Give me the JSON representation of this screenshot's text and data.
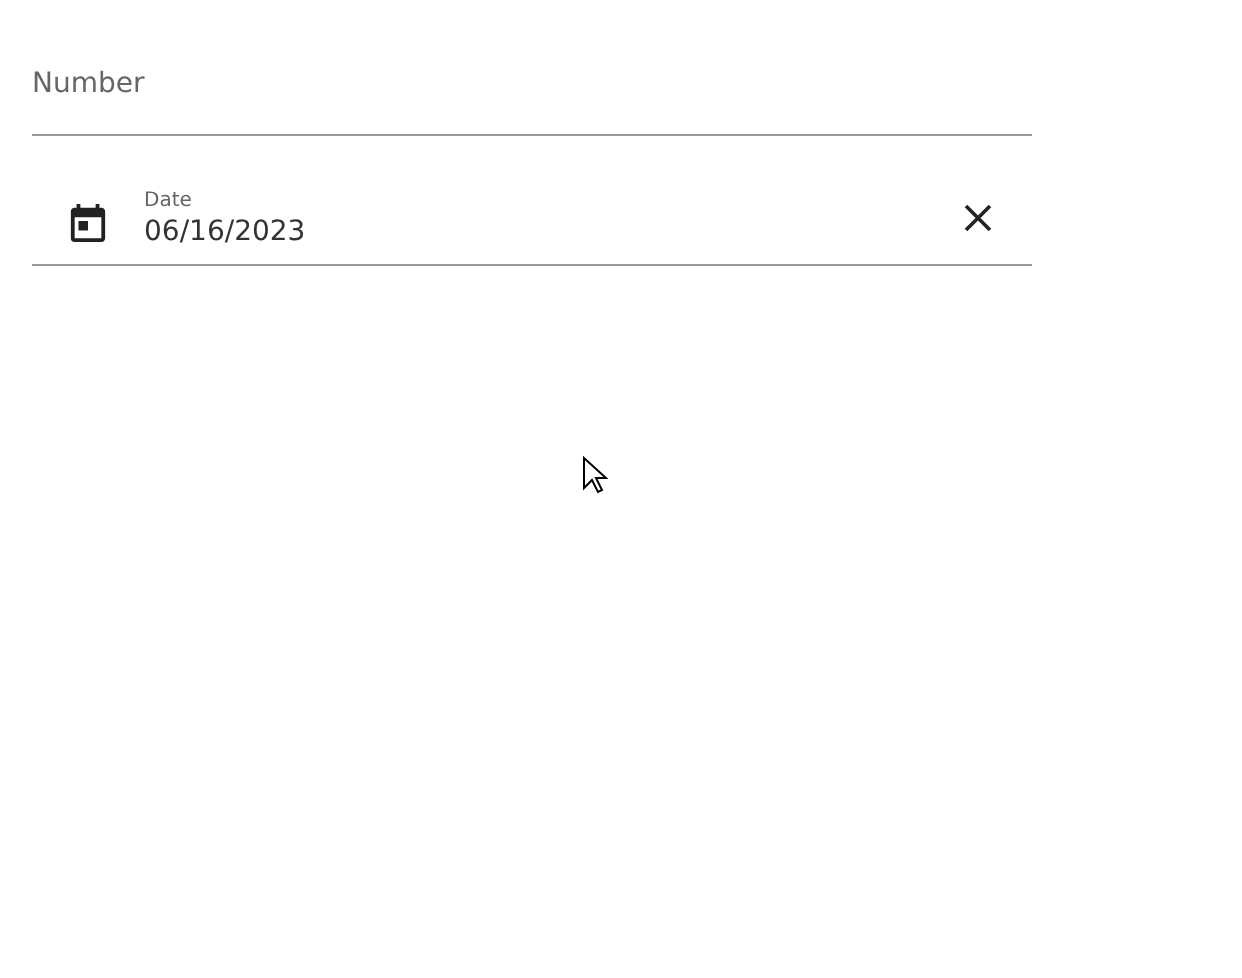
{
  "number_field": {
    "placeholder": "Number"
  },
  "date_field": {
    "label": "Date",
    "value": "06/16/2023"
  }
}
